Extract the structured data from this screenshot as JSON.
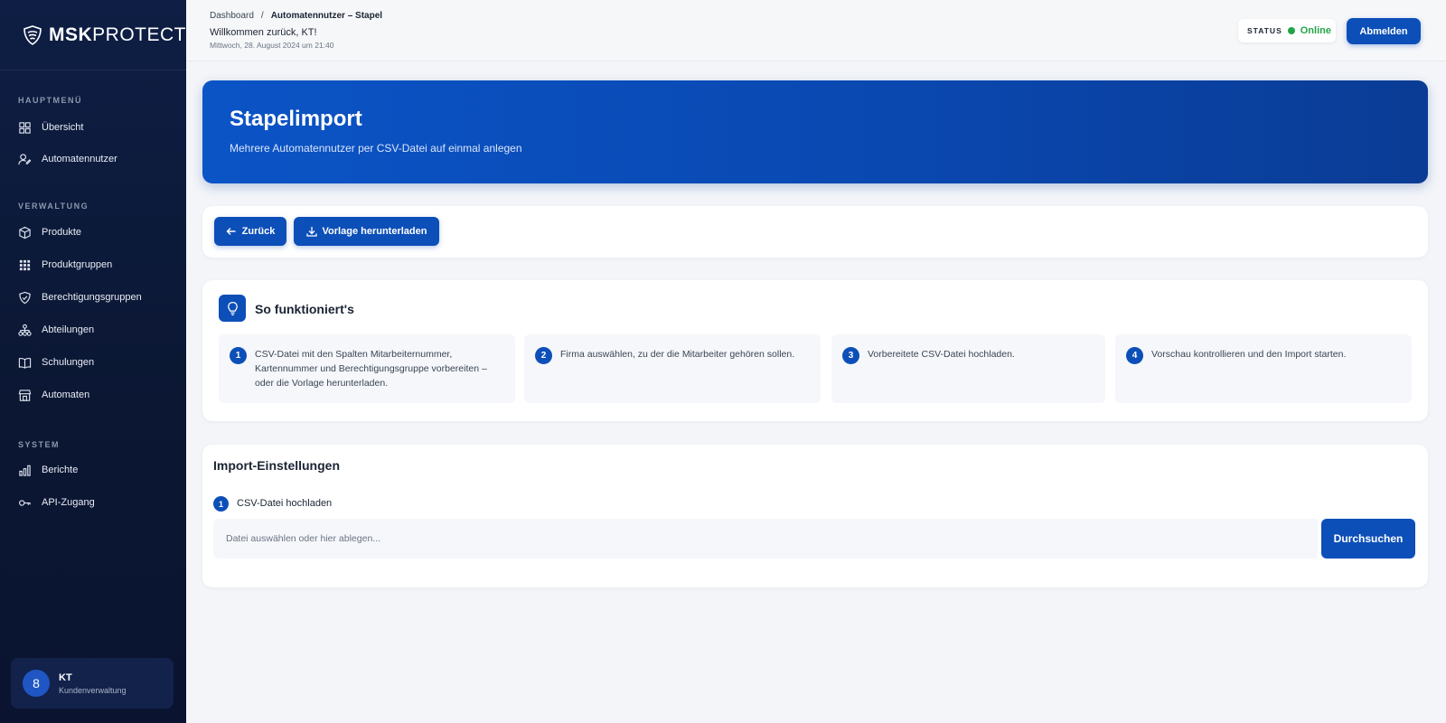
{
  "brand": {
    "bold": "MSK",
    "light": "PROTECT"
  },
  "sidebar": {
    "sections": [
      {
        "label": "HAUPTMENÜ"
      },
      {
        "label": "VERWALTUNG"
      },
      {
        "label": "SYSTEM"
      }
    ],
    "items": [
      {
        "label": "Übersicht",
        "icon": "grid-icon"
      },
      {
        "label": "Automatennutzer",
        "icon": "user-edit-icon"
      },
      {
        "label": "Produkte",
        "icon": "box-icon"
      },
      {
        "label": "Produktgruppen",
        "icon": "dots-grid-icon"
      },
      {
        "label": "Berechtigungsgruppen",
        "icon": "shield-check-icon"
      },
      {
        "label": "Abteilungen",
        "icon": "org-chart-icon"
      },
      {
        "label": "Schulungen",
        "icon": "book-icon"
      },
      {
        "label": "Automaten",
        "icon": "store-icon"
      },
      {
        "label": "Berichte",
        "icon": "bar-chart-icon"
      },
      {
        "label": "API-Zugang",
        "icon": "key-icon"
      }
    ],
    "user": {
      "avatar": "8",
      "name": "KT",
      "role": "Kundenverwaltung"
    }
  },
  "header": {
    "breadcrumb_root": "Dashboard",
    "breadcrumb_sep": "/",
    "breadcrumb_current": "Automatennutzer – Stapel",
    "welcome": "Willkommen zurück, KT!",
    "datetime": "Mittwoch, 28. August 2024 um 21:40",
    "status_label": "STATUS",
    "status_value": "Online",
    "status_color": "#22a447",
    "logout_label": "Abmelden"
  },
  "hero": {
    "title": "Stapelimport",
    "subtitle": "Mehrere Automatennutzer per CSV-Datei auf einmal anlegen"
  },
  "actions": {
    "back_label": "Zurück",
    "template_label": "Vorlage herunterladen"
  },
  "how": {
    "title": "So funktioniert's",
    "steps": [
      {
        "num": "1",
        "text": "CSV-Datei mit den Spalten Mitarbeiternummer, Kartennummer und Berechtigungsgruppe vorbereiten – oder die Vorlage herunterladen."
      },
      {
        "num": "2",
        "text": "Firma auswählen, zu der die Mitarbeiter gehören sollen."
      },
      {
        "num": "3",
        "text": "Vorbereitete CSV-Datei hochladen."
      },
      {
        "num": "4",
        "text": "Vorschau kontrollieren und den Import starten."
      }
    ]
  },
  "settings": {
    "title": "Import-Einstellungen",
    "step_num": "1",
    "upload_label": "CSV-Datei hochladen",
    "file_placeholder": "Datei auswählen oder hier ablegen...",
    "browse_label": "Durchsuchen"
  },
  "colors": {
    "primary": "#0d4fb8",
    "sidebar": "#0b1733"
  }
}
